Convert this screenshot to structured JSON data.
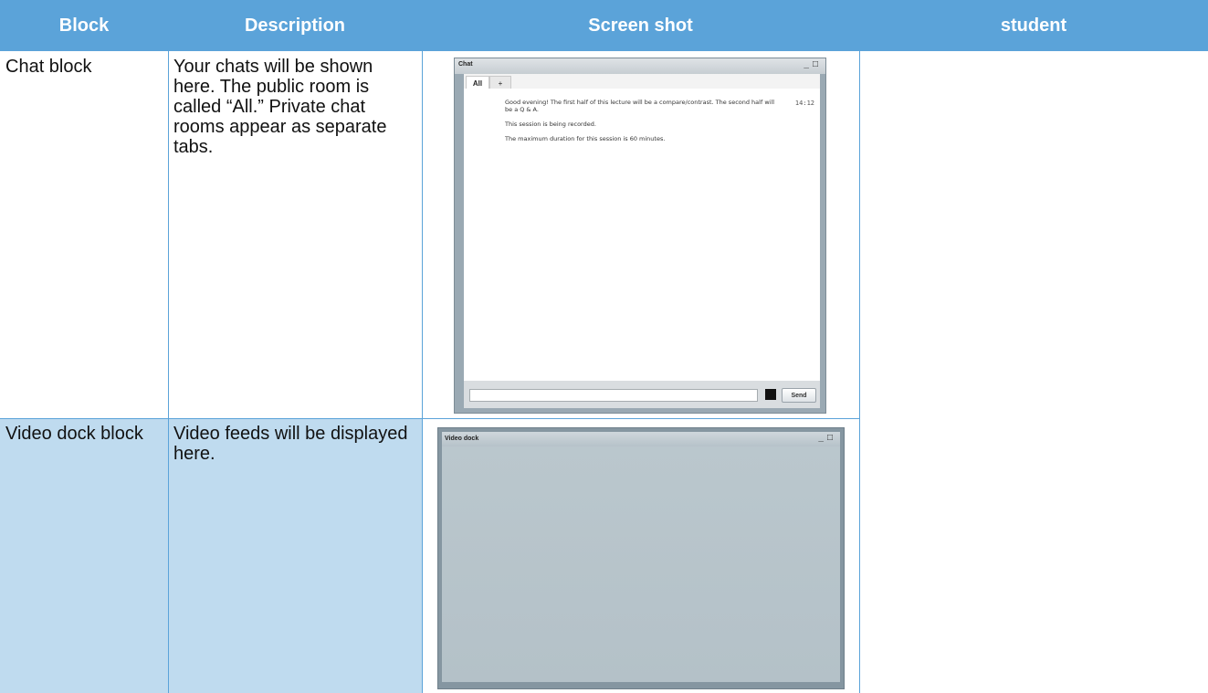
{
  "headers": {
    "block": "Block",
    "description": "Description",
    "screenshot": "Screen shot",
    "student": "student"
  },
  "rows": [
    {
      "block": "Chat block",
      "description": "Your chats will be shown here. The public room is called “All.” Private chat rooms appear as separate tabs."
    },
    {
      "block": "Video dock block",
      "description": "Video feeds will be displayed here."
    }
  ],
  "chat_window": {
    "title": "Chat",
    "tabs": [
      "All",
      "+"
    ],
    "messages": [
      "Good evening! The first half of this lecture will be a compare/contrast.  The second half will be a Q & A.",
      "This session is being recorded.",
      "The maximum duration for this session is 60 minutes."
    ],
    "time": "14:12",
    "send_label": "Send",
    "minimize_glyph": "_",
    "maximize_glyph": "□"
  },
  "video_window": {
    "title": "Video dock",
    "minimize_glyph": "_",
    "maximize_glyph": "□"
  },
  "colors": {
    "header_bg": "#5ba3d9",
    "alt_row_bg": "#bfdbef"
  }
}
